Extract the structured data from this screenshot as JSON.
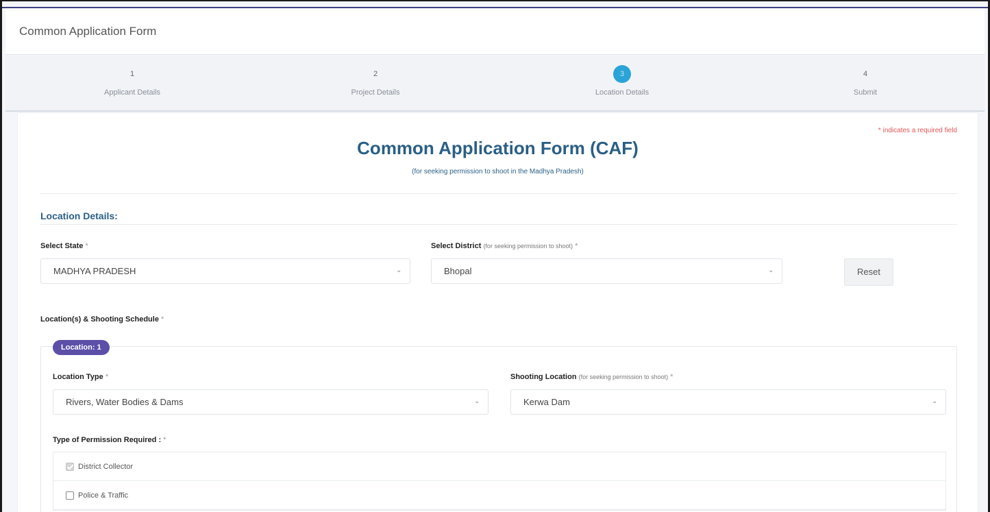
{
  "header": {
    "title": "Common Application Form"
  },
  "stepper": {
    "steps": [
      {
        "number": "1",
        "label": "Applicant Details",
        "active": false
      },
      {
        "number": "2",
        "label": "Project Details",
        "active": false
      },
      {
        "number": "3",
        "label": "Location Details",
        "active": true
      },
      {
        "number": "4",
        "label": "Submit",
        "active": false
      }
    ]
  },
  "form": {
    "required_note": "* indicates a required field",
    "title": "Common Application Form (CAF)",
    "subtitle": "(for seeking permission to shoot in the Madhya Pradesh)",
    "section_title": "Location Details:",
    "state": {
      "label": "Select State",
      "required": "*",
      "value": "MADHYA PRADESH"
    },
    "district": {
      "label": "Select District",
      "hint": "(for seeking permission to shoot)",
      "required": "*",
      "value": "Bhopal"
    },
    "reset_label": "Reset",
    "schedule_label": "Location(s) & Shooting Schedule",
    "schedule_required": "*",
    "location": {
      "badge": "Location: 1",
      "type": {
        "label": "Location Type",
        "required": "*",
        "value": "Rivers, Water Bodies & Dams"
      },
      "shooting": {
        "label": "Shooting Location",
        "hint": "(for seeking permission to shoot)",
        "required": "*",
        "value": "Kerwa Dam"
      },
      "permission_label": "Type of Permission Required :",
      "permission_required": "*",
      "permissions": [
        {
          "label": "District Collector",
          "checked": true,
          "disabled": true
        },
        {
          "label": "Police & Traffic",
          "checked": false,
          "disabled": false
        }
      ]
    }
  }
}
